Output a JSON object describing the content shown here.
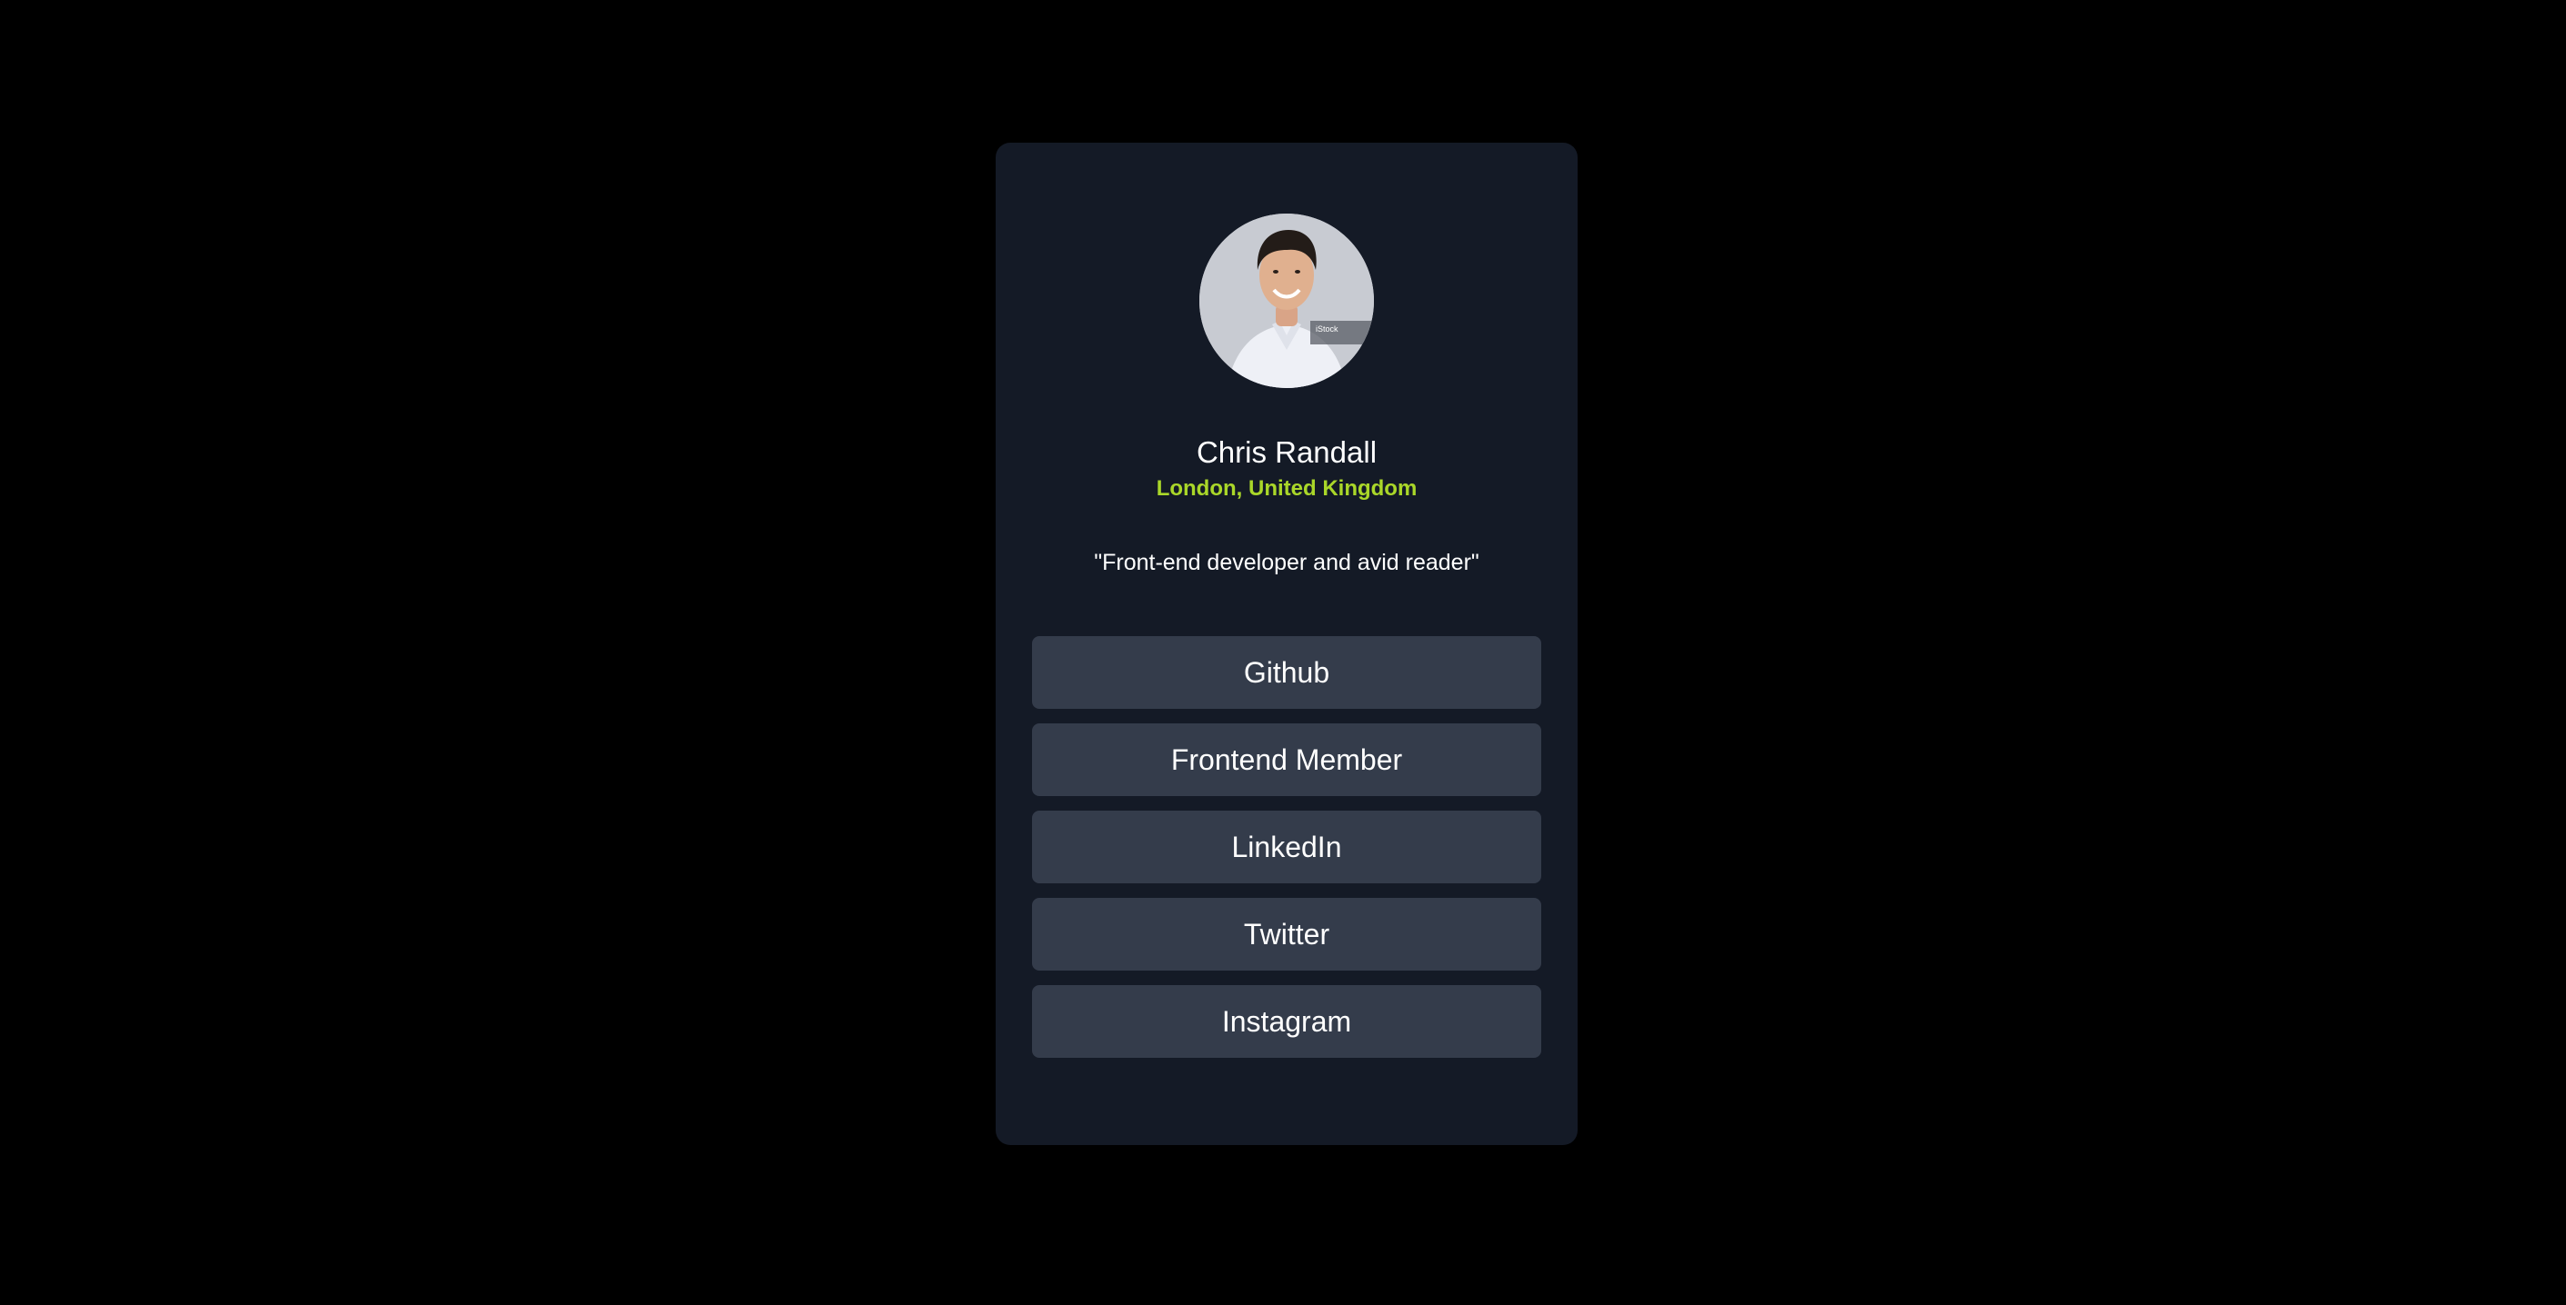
{
  "profile": {
    "name": "Chris Randall",
    "location": "London, United Kingdom",
    "bio": "\"Front-end developer and avid reader\"",
    "avatar_watermark": "iStock"
  },
  "links": [
    {
      "label": "Github"
    },
    {
      "label": "Frontend Member"
    },
    {
      "label": "LinkedIn"
    },
    {
      "label": "Twitter"
    },
    {
      "label": "Instagram"
    }
  ],
  "colors": {
    "page_background": "#000000",
    "card_background": "#141a26",
    "button_background": "#343c4b",
    "accent": "#c5f82a",
    "text": "#ffffff"
  }
}
